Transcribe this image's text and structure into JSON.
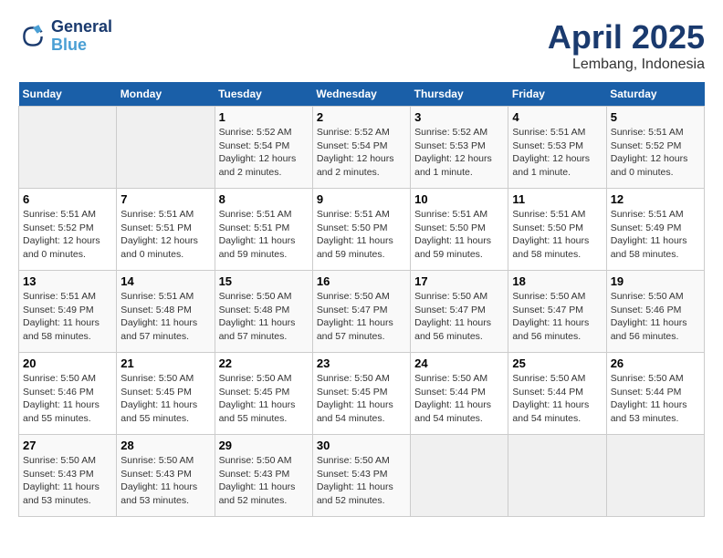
{
  "header": {
    "logo_line1": "General",
    "logo_line2": "Blue",
    "month_title": "April 2025",
    "location": "Lembang, Indonesia"
  },
  "days_of_week": [
    "Sunday",
    "Monday",
    "Tuesday",
    "Wednesday",
    "Thursday",
    "Friday",
    "Saturday"
  ],
  "weeks": [
    [
      {
        "day": "",
        "info": ""
      },
      {
        "day": "",
        "info": ""
      },
      {
        "day": "1",
        "info": "Sunrise: 5:52 AM\nSunset: 5:54 PM\nDaylight: 12 hours and 2 minutes."
      },
      {
        "day": "2",
        "info": "Sunrise: 5:52 AM\nSunset: 5:54 PM\nDaylight: 12 hours and 2 minutes."
      },
      {
        "day": "3",
        "info": "Sunrise: 5:52 AM\nSunset: 5:53 PM\nDaylight: 12 hours and 1 minute."
      },
      {
        "day": "4",
        "info": "Sunrise: 5:51 AM\nSunset: 5:53 PM\nDaylight: 12 hours and 1 minute."
      },
      {
        "day": "5",
        "info": "Sunrise: 5:51 AM\nSunset: 5:52 PM\nDaylight: 12 hours and 0 minutes."
      }
    ],
    [
      {
        "day": "6",
        "info": "Sunrise: 5:51 AM\nSunset: 5:52 PM\nDaylight: 12 hours and 0 minutes."
      },
      {
        "day": "7",
        "info": "Sunrise: 5:51 AM\nSunset: 5:51 PM\nDaylight: 12 hours and 0 minutes."
      },
      {
        "day": "8",
        "info": "Sunrise: 5:51 AM\nSunset: 5:51 PM\nDaylight: 11 hours and 59 minutes."
      },
      {
        "day": "9",
        "info": "Sunrise: 5:51 AM\nSunset: 5:50 PM\nDaylight: 11 hours and 59 minutes."
      },
      {
        "day": "10",
        "info": "Sunrise: 5:51 AM\nSunset: 5:50 PM\nDaylight: 11 hours and 59 minutes."
      },
      {
        "day": "11",
        "info": "Sunrise: 5:51 AM\nSunset: 5:50 PM\nDaylight: 11 hours and 58 minutes."
      },
      {
        "day": "12",
        "info": "Sunrise: 5:51 AM\nSunset: 5:49 PM\nDaylight: 11 hours and 58 minutes."
      }
    ],
    [
      {
        "day": "13",
        "info": "Sunrise: 5:51 AM\nSunset: 5:49 PM\nDaylight: 11 hours and 58 minutes."
      },
      {
        "day": "14",
        "info": "Sunrise: 5:51 AM\nSunset: 5:48 PM\nDaylight: 11 hours and 57 minutes."
      },
      {
        "day": "15",
        "info": "Sunrise: 5:50 AM\nSunset: 5:48 PM\nDaylight: 11 hours and 57 minutes."
      },
      {
        "day": "16",
        "info": "Sunrise: 5:50 AM\nSunset: 5:47 PM\nDaylight: 11 hours and 57 minutes."
      },
      {
        "day": "17",
        "info": "Sunrise: 5:50 AM\nSunset: 5:47 PM\nDaylight: 11 hours and 56 minutes."
      },
      {
        "day": "18",
        "info": "Sunrise: 5:50 AM\nSunset: 5:47 PM\nDaylight: 11 hours and 56 minutes."
      },
      {
        "day": "19",
        "info": "Sunrise: 5:50 AM\nSunset: 5:46 PM\nDaylight: 11 hours and 56 minutes."
      }
    ],
    [
      {
        "day": "20",
        "info": "Sunrise: 5:50 AM\nSunset: 5:46 PM\nDaylight: 11 hours and 55 minutes."
      },
      {
        "day": "21",
        "info": "Sunrise: 5:50 AM\nSunset: 5:45 PM\nDaylight: 11 hours and 55 minutes."
      },
      {
        "day": "22",
        "info": "Sunrise: 5:50 AM\nSunset: 5:45 PM\nDaylight: 11 hours and 55 minutes."
      },
      {
        "day": "23",
        "info": "Sunrise: 5:50 AM\nSunset: 5:45 PM\nDaylight: 11 hours and 54 minutes."
      },
      {
        "day": "24",
        "info": "Sunrise: 5:50 AM\nSunset: 5:44 PM\nDaylight: 11 hours and 54 minutes."
      },
      {
        "day": "25",
        "info": "Sunrise: 5:50 AM\nSunset: 5:44 PM\nDaylight: 11 hours and 54 minutes."
      },
      {
        "day": "26",
        "info": "Sunrise: 5:50 AM\nSunset: 5:44 PM\nDaylight: 11 hours and 53 minutes."
      }
    ],
    [
      {
        "day": "27",
        "info": "Sunrise: 5:50 AM\nSunset: 5:43 PM\nDaylight: 11 hours and 53 minutes."
      },
      {
        "day": "28",
        "info": "Sunrise: 5:50 AM\nSunset: 5:43 PM\nDaylight: 11 hours and 53 minutes."
      },
      {
        "day": "29",
        "info": "Sunrise: 5:50 AM\nSunset: 5:43 PM\nDaylight: 11 hours and 52 minutes."
      },
      {
        "day": "30",
        "info": "Sunrise: 5:50 AM\nSunset: 5:43 PM\nDaylight: 11 hours and 52 minutes."
      },
      {
        "day": "",
        "info": ""
      },
      {
        "day": "",
        "info": ""
      },
      {
        "day": "",
        "info": ""
      }
    ]
  ]
}
